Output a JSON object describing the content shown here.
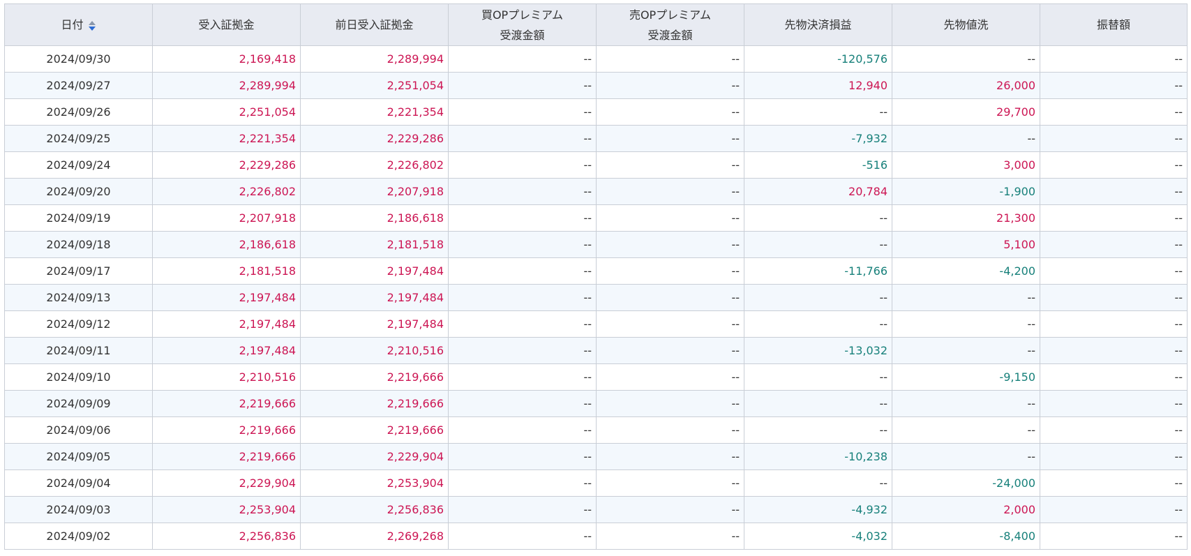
{
  "table": {
    "columns": [
      {
        "lines": [
          "日付"
        ],
        "sortable": true
      },
      {
        "lines": [
          "受入証拠金"
        ]
      },
      {
        "lines": [
          "前日受入証拠金"
        ]
      },
      {
        "lines": [
          "買OPプレミアム",
          "受渡金額"
        ]
      },
      {
        "lines": [
          "売OPプレミアム",
          "受渡金額"
        ]
      },
      {
        "lines": [
          "先物決済損益"
        ]
      },
      {
        "lines": [
          "先物値洗"
        ]
      },
      {
        "lines": [
          "振替額"
        ]
      }
    ],
    "rows": [
      [
        "2024/09/30",
        "2,169,418",
        "2,289,994",
        "--",
        "--",
        "-120,576",
        "--",
        "--"
      ],
      [
        "2024/09/27",
        "2,289,994",
        "2,251,054",
        "--",
        "--",
        "12,940",
        "26,000",
        "--"
      ],
      [
        "2024/09/26",
        "2,251,054",
        "2,221,354",
        "--",
        "--",
        "--",
        "29,700",
        "--"
      ],
      [
        "2024/09/25",
        "2,221,354",
        "2,229,286",
        "--",
        "--",
        "-7,932",
        "--",
        "--"
      ],
      [
        "2024/09/24",
        "2,229,286",
        "2,226,802",
        "--",
        "--",
        "-516",
        "3,000",
        "--"
      ],
      [
        "2024/09/20",
        "2,226,802",
        "2,207,918",
        "--",
        "--",
        "20,784",
        "-1,900",
        "--"
      ],
      [
        "2024/09/19",
        "2,207,918",
        "2,186,618",
        "--",
        "--",
        "--",
        "21,300",
        "--"
      ],
      [
        "2024/09/18",
        "2,186,618",
        "2,181,518",
        "--",
        "--",
        "--",
        "5,100",
        "--"
      ],
      [
        "2024/09/17",
        "2,181,518",
        "2,197,484",
        "--",
        "--",
        "-11,766",
        "-4,200",
        "--"
      ],
      [
        "2024/09/13",
        "2,197,484",
        "2,197,484",
        "--",
        "--",
        "--",
        "--",
        "--"
      ],
      [
        "2024/09/12",
        "2,197,484",
        "2,197,484",
        "--",
        "--",
        "--",
        "--",
        "--"
      ],
      [
        "2024/09/11",
        "2,197,484",
        "2,210,516",
        "--",
        "--",
        "-13,032",
        "--",
        "--"
      ],
      [
        "2024/09/10",
        "2,210,516",
        "2,219,666",
        "--",
        "--",
        "--",
        "-9,150",
        "--"
      ],
      [
        "2024/09/09",
        "2,219,666",
        "2,219,666",
        "--",
        "--",
        "--",
        "--",
        "--"
      ],
      [
        "2024/09/06",
        "2,219,666",
        "2,219,666",
        "--",
        "--",
        "--",
        "--",
        "--"
      ],
      [
        "2024/09/05",
        "2,219,666",
        "2,229,904",
        "--",
        "--",
        "-10,238",
        "--",
        "--"
      ],
      [
        "2024/09/04",
        "2,229,904",
        "2,253,904",
        "--",
        "--",
        "--",
        "-24,000",
        "--"
      ],
      [
        "2024/09/03",
        "2,253,904",
        "2,256,836",
        "--",
        "--",
        "-4,932",
        "2,000",
        "--"
      ],
      [
        "2024/09/02",
        "2,256,836",
        "2,269,268",
        "--",
        "--",
        "-4,032",
        "-8,400",
        "--"
      ]
    ]
  },
  "colors": {
    "positive": "#cc1553",
    "negative": "#17807a",
    "header_bg": "#e8ebf2",
    "stripe_bg": "#f3f8fd",
    "border": "#c9ced6",
    "sort_icon_up": "#8a97ab",
    "sort_icon_down": "#2b6bd3"
  },
  "icons": {
    "sort": "sort-icon"
  }
}
